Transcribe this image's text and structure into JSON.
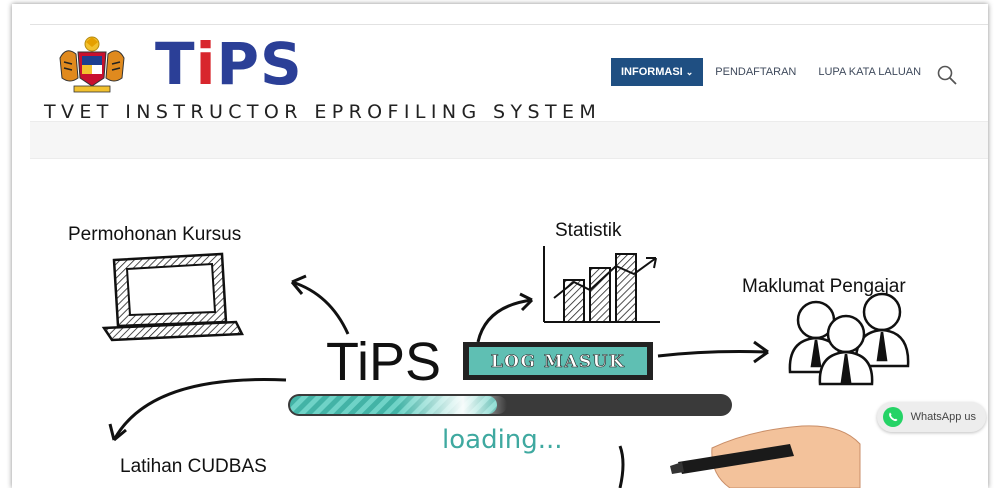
{
  "brand": {
    "logo_text": "TiPS",
    "tagline": "TVET INSTRUCTOR EPROFILING SYSTEM"
  },
  "nav": {
    "items": [
      {
        "label": "INFORMASI",
        "active": true,
        "has_dropdown": true
      },
      {
        "label": "PENDAFTARAN",
        "active": false
      },
      {
        "label": "LUPA KATA LALUAN",
        "active": false
      }
    ],
    "search_icon": "search-icon"
  },
  "banner": {
    "permohonan": "Permohonan Kursus",
    "statistik": "Statistik",
    "maklumat": "Maklumat Pengajar",
    "latihan": "Latihan CUDBAS",
    "tips_word": "TiPS",
    "login_button": "LOG MASUK",
    "loading": "loading...",
    "progress": 0.47
  },
  "whatsapp": {
    "label": "WhatsApp us",
    "icon": "whatsapp-icon"
  },
  "colors": {
    "nav_active_bg": "#1f4f82",
    "logo_blue": "#2b3f97",
    "logo_red": "#d8262d",
    "login_bg": "#5fbfb3",
    "loading_text": "#3fa9a0",
    "whatsapp_green": "#25d366"
  }
}
